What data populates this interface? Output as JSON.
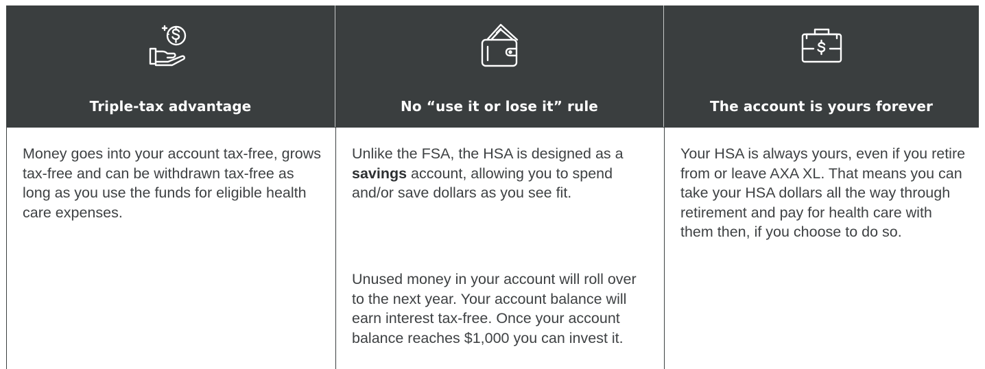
{
  "columns": [
    {
      "icon": "hand-dollar-coin-icon",
      "title": "Triple-tax advantage",
      "paragraphs": [
        "Money goes into your account tax-free, grows tax-free and can be withdrawn tax-free as long as you use the funds for eligible health care expenses."
      ]
    },
    {
      "icon": "wallet-cash-icon",
      "title": "No “use it or lose it” rule",
      "p1_before": "Unlike the FSA, the HSA is designed as a ",
      "p1_bold": "savings",
      "p1_after": " account, allowing you to spend and/or save dollars as you see fit.",
      "p2": "Unused money in your account will roll over to the next year. Your account balance will earn interest tax-free. Once your account balance reaches $1,000 you can invest it."
    },
    {
      "icon": "briefcase-dollar-icon",
      "title": "The account is yours forever",
      "paragraphs": [
        "Your HSA is always yours, even if you retire from or leave AXA XL. That means you can take your HSA dollars all the way through retirement and pay for health care with them then, if you choose to do so."
      ]
    }
  ],
  "colors": {
    "header_bg": "#3a3e3f",
    "header_text": "#ffffff",
    "body_text": "#3e4143"
  }
}
